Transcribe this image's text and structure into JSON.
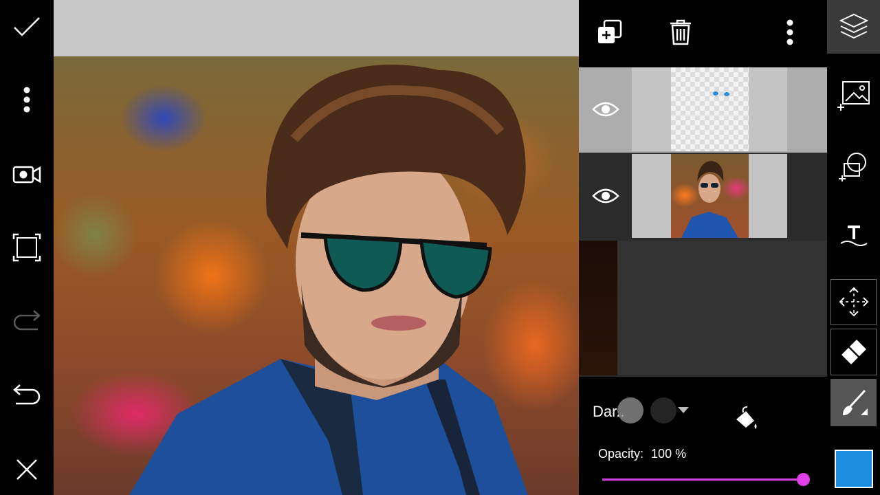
{
  "left_toolbar": {
    "items": [
      {
        "icon": "check-icon",
        "name": "apply"
      },
      {
        "icon": "more-vertical-icon",
        "name": "more-options"
      },
      {
        "icon": "video-record-icon",
        "name": "record"
      },
      {
        "icon": "crop-frame-icon",
        "name": "crop"
      },
      {
        "icon": "redo-icon",
        "name": "redo"
      },
      {
        "icon": "undo-icon",
        "name": "undo"
      },
      {
        "icon": "close-icon",
        "name": "close"
      }
    ]
  },
  "layers_panel": {
    "header_icons": [
      "add-layer-icon",
      "delete-icon",
      "more-vertical-icon"
    ],
    "layers": [
      {
        "visible": true,
        "thumbnail": "transparent-layer-with-blue-marks",
        "selected": true
      },
      {
        "visible": true,
        "thumbnail": "portrait-photo",
        "selected": false
      }
    ],
    "blend_mode": "Dar..",
    "opacity_label": "Opacity:",
    "opacity_value": "100 %",
    "opacity": 1.0
  },
  "right_toolbar": {
    "items": [
      {
        "icon": "layers-icon",
        "active": true
      },
      {
        "icon": "add-image-icon",
        "active": false
      },
      {
        "icon": "add-shape-icon",
        "active": false
      },
      {
        "icon": "text-icon",
        "active": false
      },
      {
        "icon": "move-icon",
        "active": false
      },
      {
        "icon": "eraser-icon",
        "active": false
      },
      {
        "icon": "brush-icon",
        "active": true
      }
    ],
    "current_color": "#1e8fe0"
  },
  "colors": {
    "accent": "#e040e8",
    "color_swatch": "#1e8fe0"
  }
}
